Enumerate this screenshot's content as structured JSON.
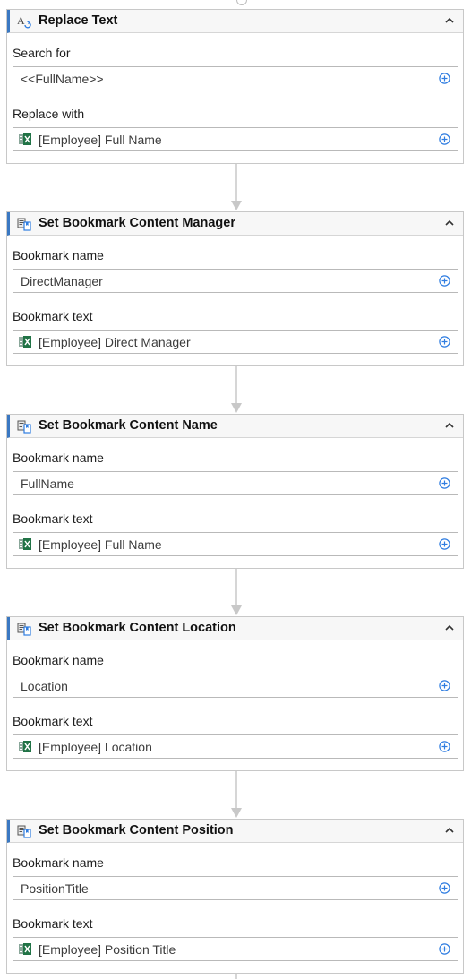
{
  "cards": [
    {
      "title": "Replace Text",
      "icon": "replace-text-icon",
      "label1": "Search for",
      "value1": "<<FullName>>",
      "label2": "Replace with",
      "value2": "[Employee] Full Name"
    },
    {
      "title": "Set Bookmark Content Manager",
      "icon": "bookmark-content-icon",
      "label1": "Bookmark name",
      "value1": "DirectManager",
      "label2": "Bookmark text",
      "value2": "[Employee] Direct Manager"
    },
    {
      "title": "Set Bookmark Content Name",
      "icon": "bookmark-content-icon",
      "label1": "Bookmark name",
      "value1": "FullName",
      "label2": "Bookmark text",
      "value2": "[Employee] Full Name"
    },
    {
      "title": "Set Bookmark Content Location",
      "icon": "bookmark-content-icon",
      "label1": "Bookmark name",
      "value1": "Location",
      "label2": "Bookmark text",
      "value2": "[Employee] Location"
    },
    {
      "title": "Set Bookmark Content Position",
      "icon": "bookmark-content-icon",
      "label1": "Bookmark name",
      "value1": "PositionTitle",
      "label2": "Bookmark text",
      "value2": "[Employee] Position Title"
    }
  ],
  "colors": {
    "accent": "#3a78c2",
    "excel_green": "#217346",
    "border": "#b9b9b9",
    "connector": "#c8c8c8"
  }
}
